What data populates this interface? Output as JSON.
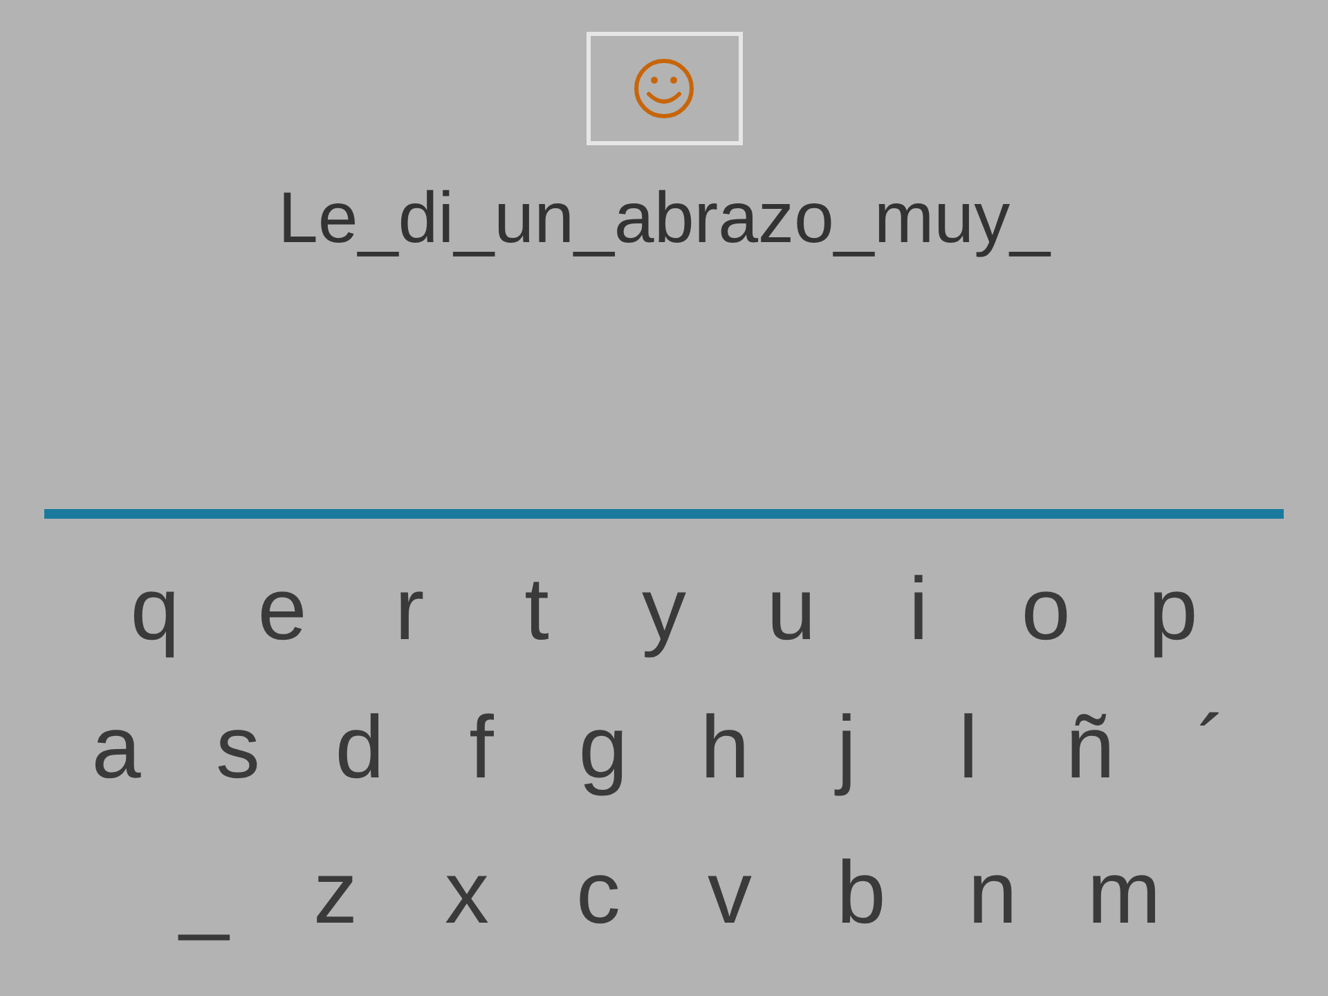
{
  "sentence": "Le_di_un_abrazo_muy_",
  "keyboard": [
    [
      "q",
      "e",
      "r",
      "t",
      "y",
      "u",
      "i",
      "o",
      "p"
    ],
    [
      "a",
      "s",
      "d",
      "f",
      "g",
      "h",
      "j",
      "l",
      "ñ",
      "´"
    ],
    [
      "_",
      "z",
      "x",
      "c",
      "v",
      "b",
      "n",
      "m"
    ]
  ]
}
